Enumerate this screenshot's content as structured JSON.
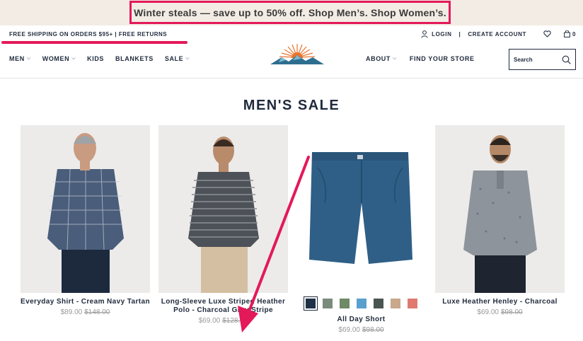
{
  "promo": {
    "text": "Winter steals — save up to 50% off. Shop Men’s. Shop Women’s."
  },
  "utility": {
    "shipping": "FREE SHIPPING ON ORDERS $95+ | FREE RETURNS",
    "login": "LOGIN",
    "separator": "|",
    "create_account": "CREATE ACCOUNT",
    "bag_count": "0",
    "icons": [
      "user-icon",
      "heart-icon",
      "bag-icon"
    ]
  },
  "nav": {
    "left": [
      {
        "label": "MEN",
        "dropdown": true
      },
      {
        "label": "WOMEN",
        "dropdown": true
      },
      {
        "label": "KIDS",
        "dropdown": false
      },
      {
        "label": "BLANKETS",
        "dropdown": false
      },
      {
        "label": "SALE",
        "dropdown": true
      }
    ],
    "right": [
      {
        "label": "ABOUT",
        "dropdown": true
      },
      {
        "label": "FIND YOUR STORE",
        "dropdown": false
      }
    ],
    "search_placeholder": "Search"
  },
  "page_title": "MEN'S SALE",
  "products": [
    {
      "name": "Everyday Shirt - Cream Navy Tartan",
      "price": "$89.00",
      "original": "$148.00"
    },
    {
      "name": "Long-Sleeve Luxe Striped Heather Polo - Charcoal Grey Stripe",
      "price": "$69.00",
      "original": "$128.00"
    },
    {
      "name": "All Day Short",
      "price": "$69.00",
      "original": "$98.00",
      "swatches": [
        "#1f3147",
        "#7b8b7c",
        "#6e8a66",
        "#5aa0cf",
        "#4a5552",
        "#c9a88c",
        "#e07a70"
      ]
    },
    {
      "name": "Luxe Heather Henley - Charcoal",
      "price": "$69.00",
      "original": "$98.00"
    }
  ],
  "colors": {
    "accent": "#e3195a",
    "navy": "#1f2a3c",
    "banner_bg": "#f3ece4"
  }
}
